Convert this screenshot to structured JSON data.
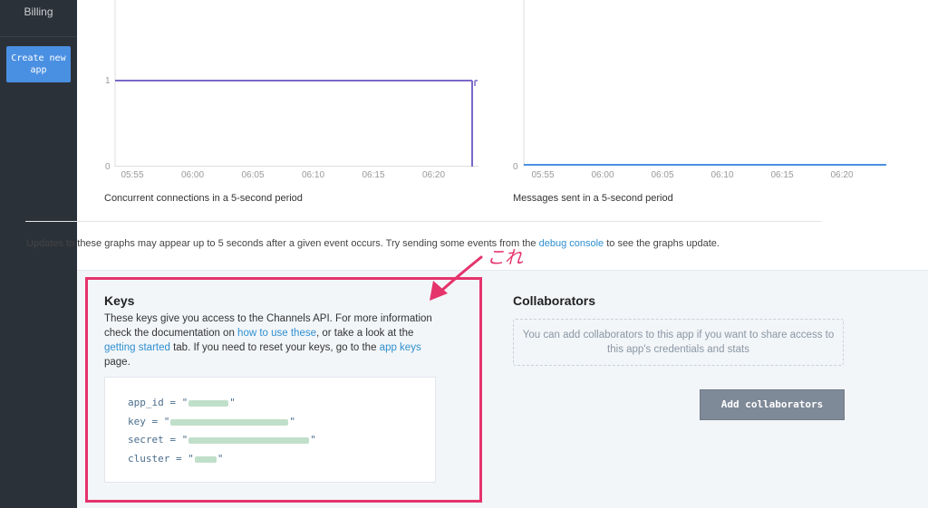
{
  "sidebar": {
    "billing_label": "Billing",
    "create_app_label": "Create new app"
  },
  "charts": [
    {
      "caption": "Concurrent connections in a 5-second period",
      "y_ticks": [
        "0",
        "1"
      ],
      "x_ticks": [
        "05:55",
        "06:00",
        "06:05",
        "06:10",
        "06:15",
        "06:20"
      ],
      "line_color": "#7b68c8"
    },
    {
      "caption": "Messages sent in a 5-second period",
      "y_ticks": [
        "0"
      ],
      "x_ticks": [
        "05:55",
        "06:00",
        "06:05",
        "06:10",
        "06:15",
        "06:20"
      ],
      "line_color": "#4a90e2"
    }
  ],
  "chart_data": [
    {
      "type": "line",
      "caption": "Concurrent connections in a 5-second period",
      "x": [
        "05:55",
        "06:00",
        "06:05",
        "06:10",
        "06:15",
        "06:20"
      ],
      "series": [
        {
          "values": [
            1,
            1,
            1,
            1,
            1,
            1
          ]
        }
      ],
      "ylim": [
        0,
        1
      ]
    },
    {
      "type": "line",
      "caption": "Messages sent in a 5-second period",
      "x": [
        "05:55",
        "06:00",
        "06:05",
        "06:10",
        "06:15",
        "06:20"
      ],
      "series": [
        {
          "values": [
            0,
            0,
            0,
            0,
            0,
            0
          ]
        }
      ],
      "ylim": [
        0,
        1
      ]
    }
  ],
  "updates": {
    "prefix": "Updates to these graphs may appear up to 5 seconds after a given event occurs. Try sending some events from the ",
    "link": "debug console",
    "suffix": " to see the graphs update."
  },
  "keys": {
    "title": "Keys",
    "desc_1": "These keys give you access to the Channels API. For more information check the documentation on ",
    "link_1": "how to use these",
    "desc_2": ", or take a look at the ",
    "link_2": "getting started",
    "desc_3": " tab. If you need to reset your keys, go to the ",
    "link_3": "app keys",
    "desc_4": " page.",
    "lines": [
      {
        "label": "app_id = \"",
        "close": "\""
      },
      {
        "label": "key = \"",
        "close": "\""
      },
      {
        "label": "secret = \"",
        "close": "\""
      },
      {
        "label": "cluster = \"",
        "close": "\""
      }
    ]
  },
  "collaborators": {
    "title": "Collaborators",
    "empty_text": "You can add collaborators to this app if you want to share access to this app's credentials and stats",
    "add_button": "Add collaborators"
  },
  "annotation": {
    "text": "これ",
    "color": "#e5336c"
  }
}
